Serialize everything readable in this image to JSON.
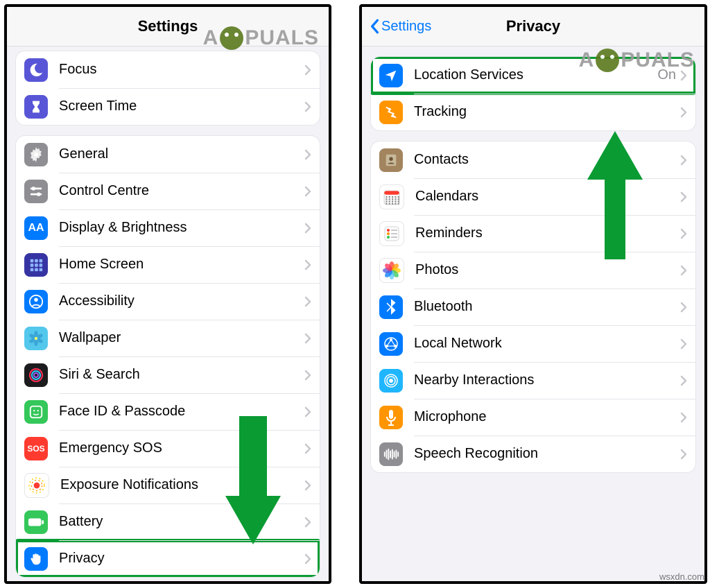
{
  "watermark": "A  PUALS",
  "credit": "wsxdn.com",
  "left": {
    "title": "Settings",
    "groups": [
      {
        "id": "personal",
        "rows": [
          {
            "key": "focus",
            "label": "Focus",
            "icon": {
              "bg": "#5856d6",
              "glyph": "moon"
            }
          },
          {
            "key": "screen-time",
            "label": "Screen Time",
            "icon": {
              "bg": "#5856d6",
              "glyph": "hourglass"
            }
          }
        ]
      },
      {
        "id": "general",
        "rows": [
          {
            "key": "general",
            "label": "General",
            "icon": {
              "bg": "#8e8e93",
              "glyph": "gear"
            }
          },
          {
            "key": "control-centre",
            "label": "Control Centre",
            "icon": {
              "bg": "#8e8e93",
              "glyph": "sliders"
            }
          },
          {
            "key": "display",
            "label": "Display & Brightness",
            "icon": {
              "bg": "#007aff",
              "glyph": "text"
            }
          },
          {
            "key": "home-screen",
            "label": "Home Screen",
            "icon": {
              "bg": "#3634a3",
              "glyph": "grid"
            }
          },
          {
            "key": "accessibility",
            "label": "Accessibility",
            "icon": {
              "bg": "#007aff",
              "glyph": "person"
            }
          },
          {
            "key": "wallpaper",
            "label": "Wallpaper",
            "icon": {
              "bg": "#54c7ec",
              "glyph": "flower"
            }
          },
          {
            "key": "siri",
            "label": "Siri & Search",
            "icon": {
              "bg": "#1c1c1e",
              "glyph": "siri"
            }
          },
          {
            "key": "faceid",
            "label": "Face ID & Passcode",
            "icon": {
              "bg": "#34c759",
              "glyph": "face"
            }
          },
          {
            "key": "sos",
            "label": "Emergency SOS",
            "icon": {
              "bg": "#ff3b30",
              "glyph": "sos"
            }
          },
          {
            "key": "exposure",
            "label": "Exposure Notifications",
            "icon": {
              "bg": "#ffffff",
              "glyph": "exposure"
            }
          },
          {
            "key": "battery",
            "label": "Battery",
            "icon": {
              "bg": "#34c759",
              "glyph": "battery"
            }
          },
          {
            "key": "privacy",
            "label": "Privacy",
            "icon": {
              "bg": "#007aff",
              "glyph": "hand"
            },
            "highlight": true
          }
        ]
      }
    ]
  },
  "right": {
    "title": "Privacy",
    "back": "Settings",
    "groups": [
      {
        "id": "loc",
        "rows": [
          {
            "key": "location",
            "label": "Location Services",
            "value": "On",
            "icon": {
              "bg": "#007aff",
              "glyph": "arrow"
            },
            "highlight": true
          },
          {
            "key": "tracking",
            "label": "Tracking",
            "icon": {
              "bg": "#ff9500",
              "glyph": "tracking"
            }
          }
        ]
      },
      {
        "id": "data",
        "rows": [
          {
            "key": "contacts",
            "label": "Contacts",
            "icon": {
              "bg": "#a2845e",
              "glyph": "contacts"
            }
          },
          {
            "key": "calendars",
            "label": "Calendars",
            "icon": {
              "bg": "#ffffff",
              "glyph": "calendar"
            }
          },
          {
            "key": "reminders",
            "label": "Reminders",
            "icon": {
              "bg": "#ffffff",
              "glyph": "reminders"
            }
          },
          {
            "key": "photos",
            "label": "Photos",
            "icon": {
              "bg": "#ffffff",
              "glyph": "photos"
            }
          },
          {
            "key": "bluetooth",
            "label": "Bluetooth",
            "icon": {
              "bg": "#007aff",
              "glyph": "bluetooth"
            }
          },
          {
            "key": "localnet",
            "label": "Local Network",
            "icon": {
              "bg": "#007aff",
              "glyph": "network"
            }
          },
          {
            "key": "nearby",
            "label": "Nearby Interactions",
            "icon": {
              "bg": "#1fb6ff",
              "glyph": "nearby"
            }
          },
          {
            "key": "microphone",
            "label": "Microphone",
            "icon": {
              "bg": "#ff9500",
              "glyph": "mic"
            }
          },
          {
            "key": "speech",
            "label": "Speech Recognition",
            "icon": {
              "bg": "#8e8e93",
              "glyph": "wave"
            }
          }
        ]
      }
    ]
  }
}
